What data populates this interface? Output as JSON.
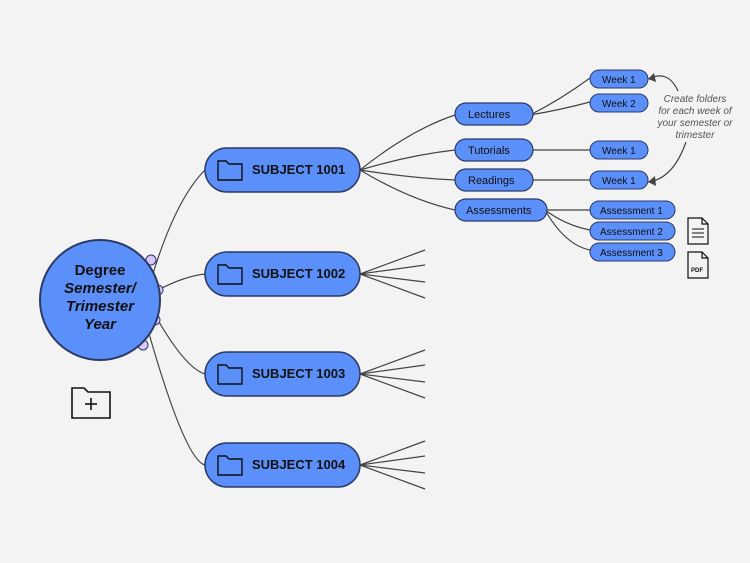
{
  "root": {
    "line1": "Degree",
    "line2": "Semester/",
    "line3": "Trimester",
    "line4": "Year"
  },
  "subjects": [
    {
      "label": "SUBJECT 1001"
    },
    {
      "label": "SUBJECT 1002"
    },
    {
      "label": "SUBJECT 1003"
    },
    {
      "label": "SUBJECT 1004"
    }
  ],
  "categories": [
    {
      "label": "Lectures"
    },
    {
      "label": "Tutorials"
    },
    {
      "label": "Readings"
    },
    {
      "label": "Assessments"
    }
  ],
  "lecture_weeks": [
    {
      "label": "Week 1"
    },
    {
      "label": "Week 2"
    }
  ],
  "tutorial_weeks": [
    {
      "label": "Week 1"
    }
  ],
  "reading_weeks": [
    {
      "label": "Week 1"
    }
  ],
  "assessments": [
    {
      "label": "Assessment 1"
    },
    {
      "label": "Assessment 2"
    },
    {
      "label": "Assessment 3"
    }
  ],
  "annotation": {
    "line1": "Create folders",
    "line2": "for each week of",
    "line3": "your semester or",
    "line4": "trimester"
  },
  "icons": {
    "add_folder": "add-folder-icon",
    "doc": "document-icon",
    "pdf": "pdf-icon"
  },
  "colors": {
    "node": "#5b8ff9",
    "stroke": "#2b3a67",
    "bg": "#f3f3f3"
  }
}
